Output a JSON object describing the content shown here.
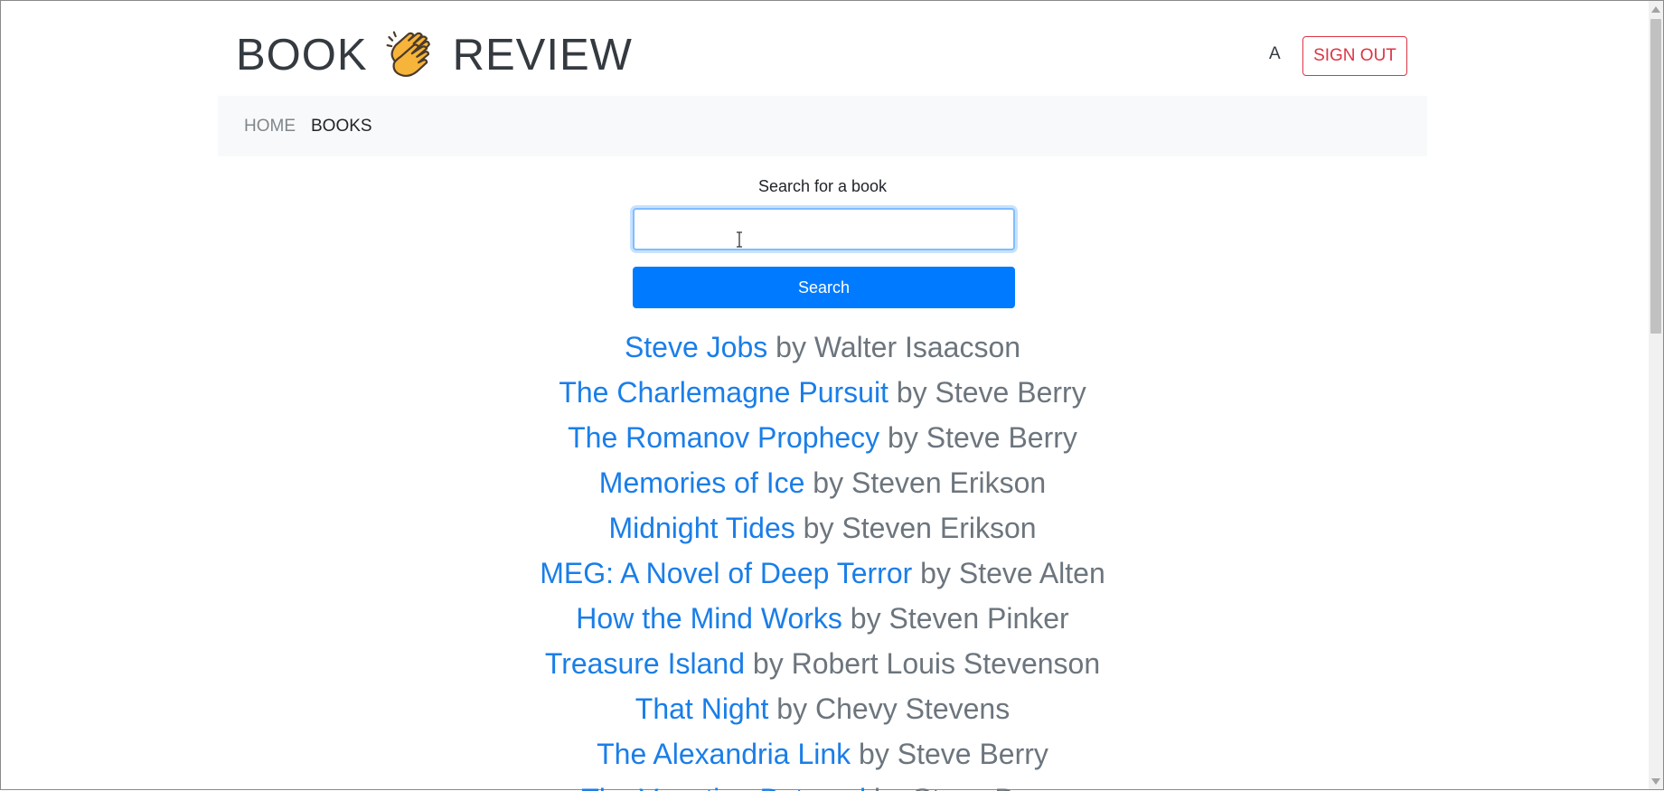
{
  "header": {
    "brand_left": "BOOK",
    "brand_icon": "clapping-hands-icon",
    "brand_right": "REVIEW",
    "user_initial": "A",
    "signout_label": "SIGN OUT"
  },
  "nav": {
    "items": [
      {
        "label": "HOME"
      },
      {
        "label": "BOOKS"
      }
    ]
  },
  "search": {
    "label": "Search for a book",
    "value": "",
    "button_label": "Search"
  },
  "books": [
    {
      "title": "Steve Jobs",
      "by": " by Walter Isaacson"
    },
    {
      "title": "The Charlemagne Pursuit",
      "by": " by Steve Berry"
    },
    {
      "title": "The Romanov Prophecy",
      "by": " by Steve Berry"
    },
    {
      "title": "Memories of Ice",
      "by": " by Steven Erikson"
    },
    {
      "title": "Midnight Tides",
      "by": " by Steven Erikson"
    },
    {
      "title": "MEG: A Novel of Deep Terror",
      "by": " by Steve Alten"
    },
    {
      "title": "How the Mind Works",
      "by": " by Steven Pinker"
    },
    {
      "title": "Treasure Island",
      "by": " by Robert Louis Stevenson"
    },
    {
      "title": "That Night",
      "by": " by Chevy Stevens"
    },
    {
      "title": "The Alexandria Link",
      "by": " by Steve Berry"
    },
    {
      "title": "The Venetian Betrayal",
      "by": " by Steve Berry"
    }
  ],
  "colors": {
    "accent": "#007bff",
    "link": "#1a7ee8",
    "danger": "#dc3545",
    "muted": "#6c757d"
  }
}
